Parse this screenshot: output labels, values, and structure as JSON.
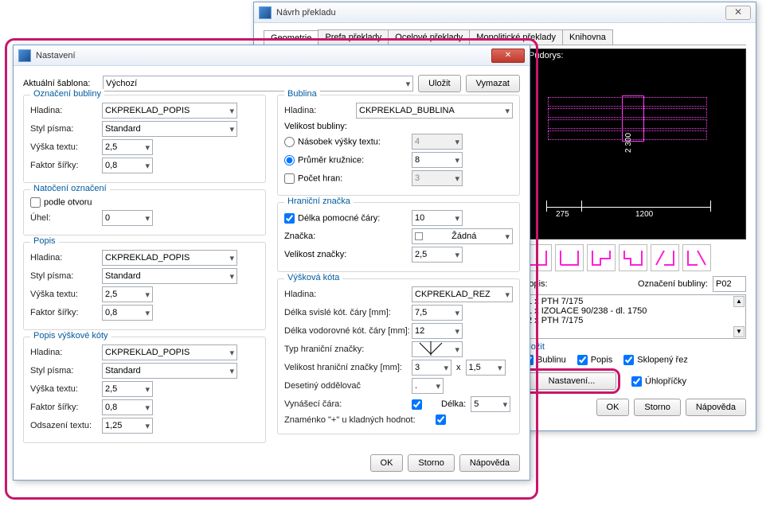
{
  "parent": {
    "title": "Návrh překladu",
    "tabs": [
      "Geometrie",
      "Prefa překlady",
      "Ocelové překlady",
      "Monolitické překlady",
      "Knihovna"
    ],
    "preview_label": "Půdorys:",
    "dims": {
      "left": "275",
      "right": "1200",
      "height": "2 300"
    },
    "popis_label": "Popis:",
    "ozn_label": "Označení bubliny:",
    "ozn_value": "P02",
    "items": [
      "1 x PTH 7/175",
      "1 x IZOLACE 90/238 - dl. 1750",
      "2 x PTH 7/175"
    ],
    "vlozit_label": "Vložit",
    "chk": {
      "bublinu": "Bublinu",
      "popis": "Popis",
      "rez": "Sklopený řez",
      "uhlo": "Úhlopříčky"
    },
    "nastaveni_btn": "Nastavení...",
    "ok": "OK",
    "storno": "Storno",
    "napoveda": "Nápověda"
  },
  "dlg": {
    "title": "Nastavení",
    "templ_lbl": "Aktuální šablona:",
    "templ_val": "Výchozí",
    "ulozit": "Uložit",
    "vymazat": "Vymazat",
    "ozn": {
      "title": "Označení bubliny",
      "hladina_lbl": "Hladina:",
      "hladina_val": "CKPREKLAD_POPIS",
      "styl_lbl": "Styl písma:",
      "styl_val": "Standard",
      "vyska_lbl": "Výška textu:",
      "vyska_val": "2,5",
      "faktor_lbl": "Faktor šířky:",
      "faktor_val": "0,8"
    },
    "nat": {
      "title": "Natočení označení",
      "podle": "podle otvoru",
      "uhel_lbl": "Úhel:",
      "uhel_val": "0"
    },
    "popis": {
      "title": "Popis",
      "hladina_val": "CKPREKLAD_POPIS",
      "styl_val": "Standard",
      "vyska_val": "2,5",
      "faktor_val": "0,8"
    },
    "pvk": {
      "title": "Popis výškové kóty",
      "hladina_val": "CKPREKLAD_POPIS",
      "styl_val": "Standard",
      "vyska_val": "2,5",
      "faktor_val": "0,8",
      "odsaz_lbl": "Odsazení textu:",
      "odsaz_val": "1,25"
    },
    "bub": {
      "title": "Bublina",
      "hladina_lbl": "Hladina:",
      "hladina_val": "CKPREKLAD_BUBLINA",
      "velikost_lbl": "Velikost bubliny:",
      "r1": "Násobek výšky textu:",
      "r1v": "4",
      "r2": "Průměr kružnice:",
      "r2v": "8",
      "r3": "Počet hran:",
      "r3v": "3"
    },
    "hz": {
      "title": "Hraniční značka",
      "delka_lbl": "Délka pomocné čáry:",
      "delka_val": "10",
      "znacka_lbl": "Značka:",
      "znacka_val": "Žádná",
      "velz_lbl": "Velikost značky:",
      "velz_val": "2,5"
    },
    "vk": {
      "title": "Výšková kóta",
      "hladina_lbl": "Hladina:",
      "hladina_val": "CKPREKLAD_REZ",
      "dsv_lbl": "Délka svislé kót. čáry [mm]:",
      "dsv_val": "7,5",
      "dvod_lbl": "Délka vodorovné kót. čáry [mm]:",
      "dvod_val": "12",
      "thz_lbl": "Typ hraniční značky:",
      "vhz_lbl": "Velikost hraniční značky [mm]:",
      "vhz_a": "3",
      "vhz_x": "x",
      "vhz_b": "1,5",
      "dodd_lbl": "Desetiný oddělovač",
      "dodd_val": ".",
      "vyn_lbl": "Vynášecí čára:",
      "vyn_delka_lbl": "Délka:",
      "vyn_delka_val": "5",
      "plus_lbl": "Znaménko \"+\" u kladných hodnot:"
    },
    "ok": "OK",
    "storno": "Storno",
    "napoveda": "Nápověda"
  }
}
